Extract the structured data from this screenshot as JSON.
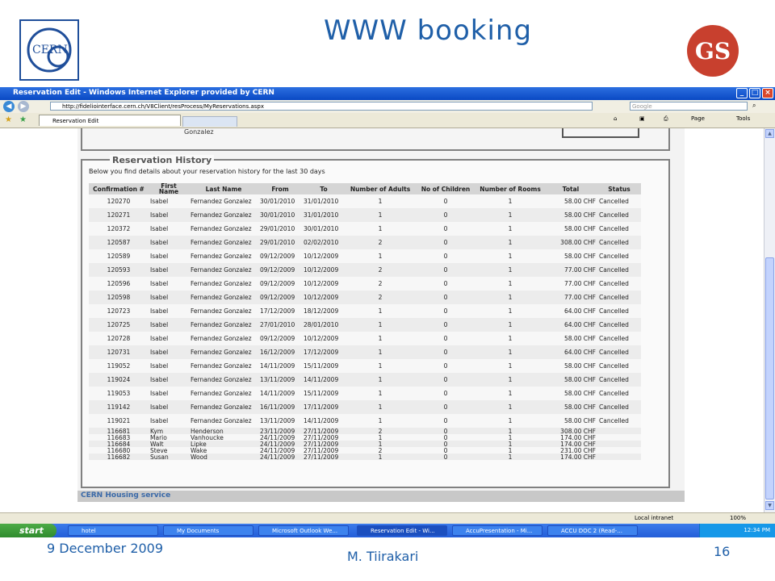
{
  "slide": {
    "title": "WWW booking",
    "date": "9 December 2009",
    "author": "M. Tiirakari",
    "page_number": "16",
    "logo_left": "CERN",
    "logo_right": "GS"
  },
  "browser": {
    "window_title": "Reservation Edit - Windows Internet Explorer provided by CERN",
    "url": "http://fideliointerface.cern.ch/V8Client/resProcess/MyReservations.aspx",
    "search_placeholder": "Google",
    "tab_label": "Reservation Edit",
    "commands": {
      "page": "Page",
      "tools": "Tools"
    },
    "status_zone": "Local intranet",
    "zoom": "100%"
  },
  "page": {
    "top_fragment": "Gonzalez",
    "section_title": "Reservation History",
    "intro": "Below you find details about your reservation history for the last 30 days",
    "footer": "CERN Housing service"
  },
  "table": {
    "headers": [
      "Confirmation #",
      "First Name",
      "Last Name",
      "From",
      "To",
      "Number of Adults",
      "No of Children",
      "Number of Rooms",
      "Total",
      "Status"
    ],
    "rows": [
      [
        "120270",
        "Isabel",
        "Fernandez Gonzalez",
        "30/01/2010",
        "31/01/2010",
        "1",
        "0",
        "1",
        "58.00 CHF",
        "Cancelled"
      ],
      [
        "120271",
        "Isabel",
        "Fernandez Gonzalez",
        "30/01/2010",
        "31/01/2010",
        "1",
        "0",
        "1",
        "58.00 CHF",
        "Cancelled"
      ],
      [
        "120372",
        "Isabel",
        "Fernandez Gonzalez",
        "29/01/2010",
        "30/01/2010",
        "1",
        "0",
        "1",
        "58.00 CHF",
        "Cancelled"
      ],
      [
        "120587",
        "Isabel",
        "Fernandez Gonzalez",
        "29/01/2010",
        "02/02/2010",
        "2",
        "0",
        "1",
        "308.00 CHF",
        "Cancelled"
      ],
      [
        "120589",
        "Isabel",
        "Fernandez Gonzalez",
        "09/12/2009",
        "10/12/2009",
        "1",
        "0",
        "1",
        "58.00 CHF",
        "Cancelled"
      ],
      [
        "120593",
        "Isabel",
        "Fernandez Gonzalez",
        "09/12/2009",
        "10/12/2009",
        "2",
        "0",
        "1",
        "77.00 CHF",
        "Cancelled"
      ],
      [
        "120596",
        "Isabel",
        "Fernandez Gonzalez",
        "09/12/2009",
        "10/12/2009",
        "2",
        "0",
        "1",
        "77.00 CHF",
        "Cancelled"
      ],
      [
        "120598",
        "Isabel",
        "Fernandez Gonzalez",
        "09/12/2009",
        "10/12/2009",
        "2",
        "0",
        "1",
        "77.00 CHF",
        "Cancelled"
      ],
      [
        "120723",
        "Isabel",
        "Fernandez Gonzalez",
        "17/12/2009",
        "18/12/2009",
        "1",
        "0",
        "1",
        "64.00 CHF",
        "Cancelled"
      ],
      [
        "120725",
        "Isabel",
        "Fernandez Gonzalez",
        "27/01/2010",
        "28/01/2010",
        "1",
        "0",
        "1",
        "64.00 CHF",
        "Cancelled"
      ],
      [
        "120728",
        "Isabel",
        "Fernandez Gonzalez",
        "09/12/2009",
        "10/12/2009",
        "1",
        "0",
        "1",
        "58.00 CHF",
        "Cancelled"
      ],
      [
        "120731",
        "Isabel",
        "Fernandez Gonzalez",
        "16/12/2009",
        "17/12/2009",
        "1",
        "0",
        "1",
        "64.00 CHF",
        "Cancelled"
      ],
      [
        "119052",
        "Isabel",
        "Fernandez Gonzalez",
        "14/11/2009",
        "15/11/2009",
        "1",
        "0",
        "1",
        "58.00 CHF",
        "Cancelled"
      ],
      [
        "119024",
        "Isabel",
        "Fernandez Gonzalez",
        "13/11/2009",
        "14/11/2009",
        "1",
        "0",
        "1",
        "58.00 CHF",
        "Cancelled"
      ],
      [
        "119053",
        "Isabel",
        "Fernandez Gonzalez",
        "14/11/2009",
        "15/11/2009",
        "1",
        "0",
        "1",
        "58.00 CHF",
        "Cancelled"
      ],
      [
        "119142",
        "Isabel",
        "Fernandez Gonzalez",
        "16/11/2009",
        "17/11/2009",
        "1",
        "0",
        "1",
        "58.00 CHF",
        "Cancelled"
      ],
      [
        "119021",
        "Isabel",
        "Fernandez Gonzalez",
        "13/11/2009",
        "14/11/2009",
        "1",
        "0",
        "1",
        "58.00 CHF",
        "Cancelled"
      ],
      [
        "116681",
        "Kym",
        "Henderson",
        "23/11/2009",
        "27/11/2009",
        "2",
        "0",
        "1",
        "308.00 CHF",
        ""
      ],
      [
        "116683",
        "Mario",
        "Vanhoucke",
        "24/11/2009",
        "27/11/2009",
        "1",
        "0",
        "1",
        "174.00 CHF",
        ""
      ],
      [
        "116684",
        "Walt",
        "Lipke",
        "24/11/2009",
        "27/11/2009",
        "1",
        "0",
        "1",
        "174.00 CHF",
        ""
      ],
      [
        "116680",
        "Steve",
        "Wake",
        "24/11/2009",
        "27/11/2009",
        "2",
        "0",
        "1",
        "231.00 CHF",
        ""
      ],
      [
        "116682",
        "Susan",
        "Wood",
        "24/11/2009",
        "27/11/2009",
        "1",
        "0",
        "1",
        "174.00 CHF",
        ""
      ]
    ]
  },
  "taskbar": {
    "start": "start",
    "items": [
      "hotel",
      "My Documents",
      "Microsoft Outlook We...",
      "Reservation Edit - Wi...",
      "AccuPresentation - Mi...",
      "ACCU DOC 2 (Read-..."
    ],
    "clock": "12:34 PM"
  },
  "colors": {
    "slide_blue": "#1f5fa8",
    "gs_red": "#c8402e",
    "xp_blue": "#245ed8"
  }
}
